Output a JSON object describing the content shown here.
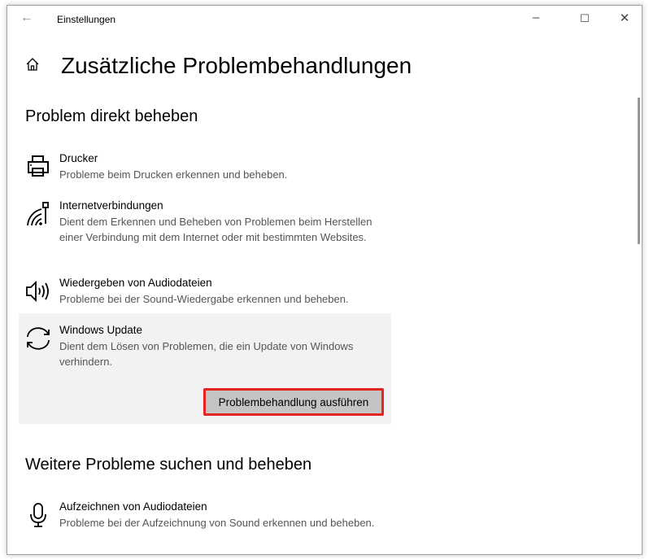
{
  "window": {
    "title": "Einstellungen",
    "minimize": "–",
    "maximize": "☐",
    "close": "✕",
    "back": "←"
  },
  "page": {
    "title": "Zusätzliche Problembehandlungen"
  },
  "section1": {
    "heading": "Problem direkt beheben",
    "items": [
      {
        "title": "Drucker",
        "desc": "Probleme beim Drucken erkennen und beheben.",
        "icon": "printer-icon"
      },
      {
        "title": "Internetverbindungen",
        "desc": "Dient dem Erkennen und Beheben von Problemen beim Herstellen einer Verbindung mit dem Internet oder mit bestimmten Websites.",
        "icon": "network-icon"
      },
      {
        "title": "Wiedergeben von Audiodateien",
        "desc": "Probleme bei der Sound-Wiedergabe erkennen und beheben.",
        "icon": "speaker-icon"
      },
      {
        "title": "Windows Update",
        "desc": "Dient dem Lösen von Problemen, die ein Update von Windows verhindern.",
        "icon": "refresh-icon",
        "button": "Problembehandlung ausführen"
      }
    ]
  },
  "section2": {
    "heading": "Weitere Probleme suchen und beheben",
    "items": [
      {
        "title": "Aufzeichnen von Audiodateien",
        "desc": "Probleme bei der Aufzeichnung von Sound erkennen und beheben.",
        "icon": "microphone-icon"
      }
    ]
  }
}
